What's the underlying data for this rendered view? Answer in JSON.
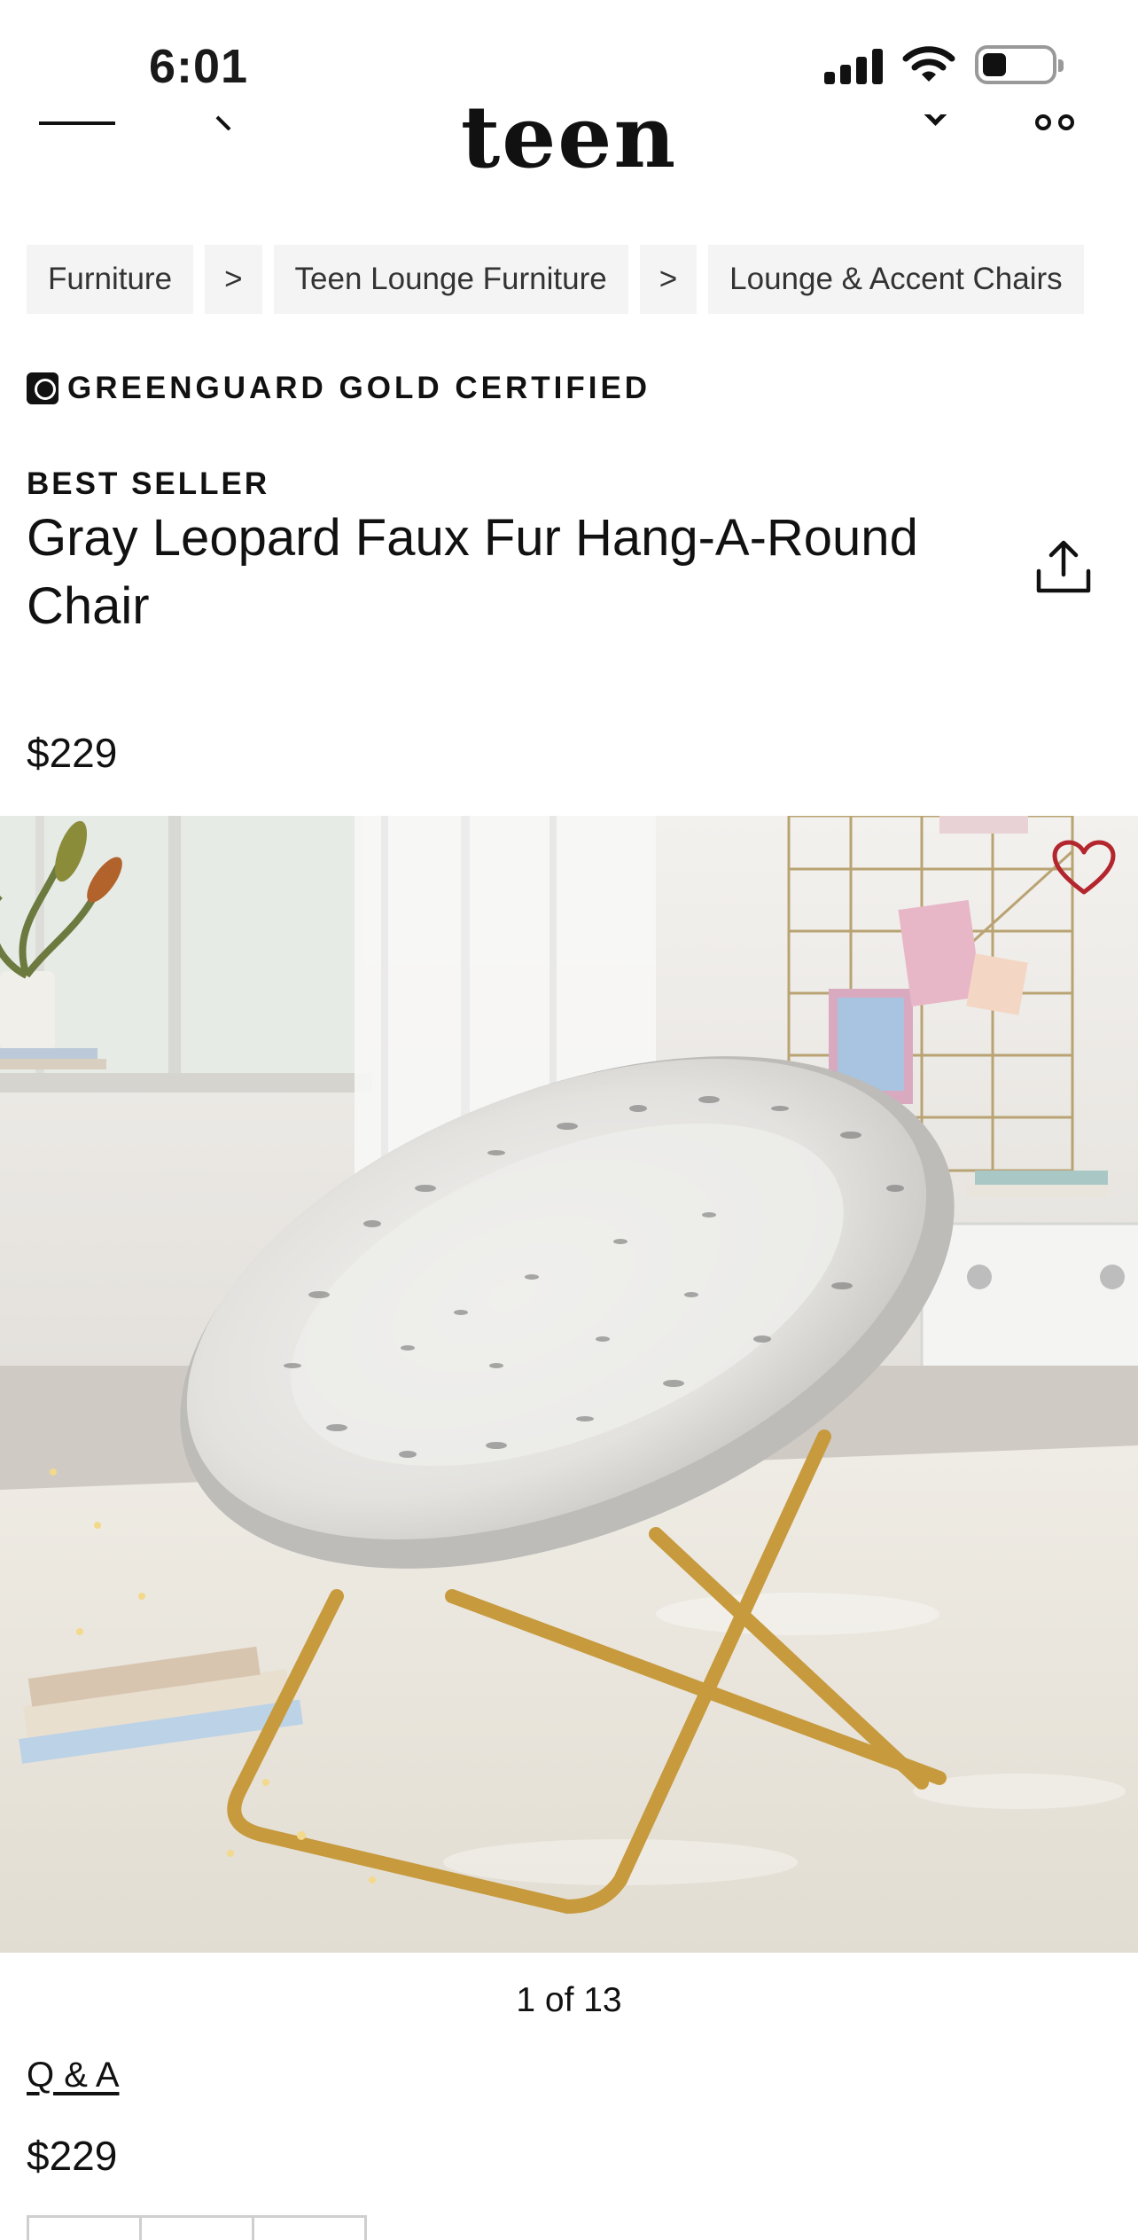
{
  "status_bar": {
    "time": "6:01"
  },
  "header": {
    "logo": "teen",
    "icons": [
      "menu-icon",
      "search-icon",
      "chevron-down-icon",
      "cart-icon"
    ]
  },
  "breadcrumb": {
    "items": [
      "Furniture",
      "Teen Lounge Furniture",
      "Lounge & Accent Chairs"
    ],
    "separator": ">"
  },
  "certification": {
    "label": "GREENGUARD GOLD CERTIFIED"
  },
  "product": {
    "badge": "BEST SELLER",
    "title": "Gray Leopard Faux Fur Hang-A-Round Chair",
    "price": "$229",
    "image_counter": "1 of 13",
    "qa_link": "Q & A",
    "price_repeat": "$229"
  },
  "colors": {
    "accent_red": "#b3262e",
    "text": "#1a1a1a",
    "crumb_bg": "#f4f4f4",
    "chair_frame": "#c79a3e"
  }
}
